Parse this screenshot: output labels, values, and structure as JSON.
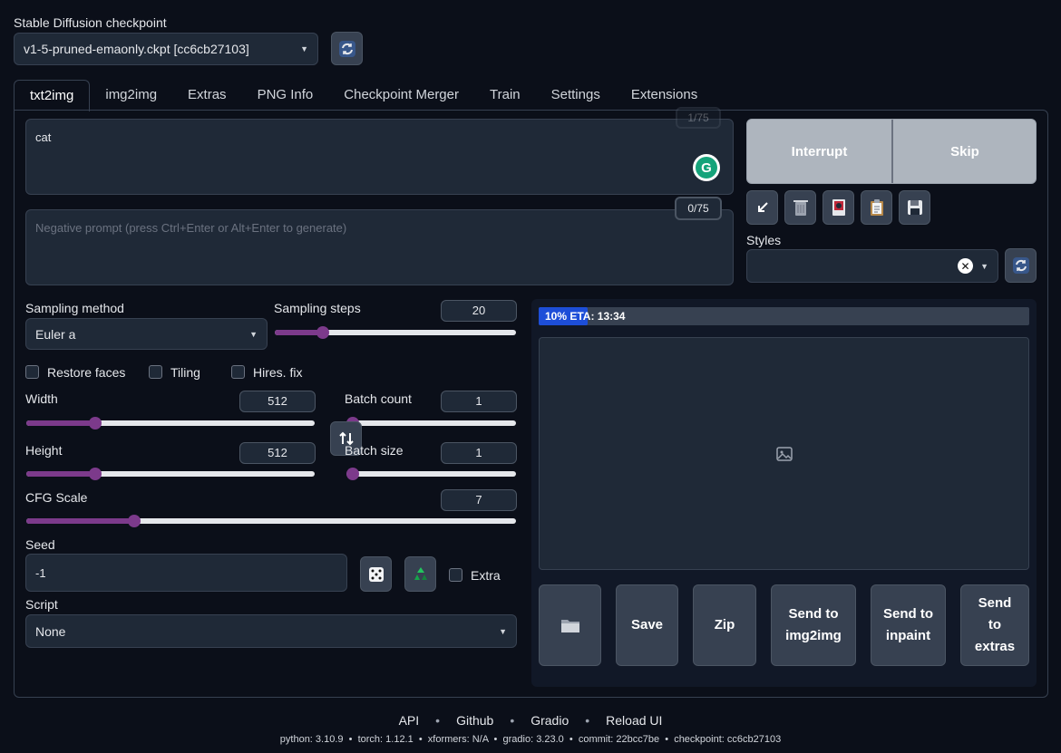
{
  "checkpoint": {
    "label": "Stable Diffusion checkpoint",
    "value": "v1-5-pruned-emaonly.ckpt [cc6cb27103]"
  },
  "tabs": [
    "txt2img",
    "img2img",
    "Extras",
    "PNG Info",
    "Checkpoint Merger",
    "Train",
    "Settings",
    "Extensions"
  ],
  "prompt": {
    "value": "cat",
    "counter": "1/75"
  },
  "negative_prompt": {
    "placeholder": "Negative prompt (press Ctrl+Enter or Alt+Enter to generate)",
    "counter": "0/75"
  },
  "actions": {
    "interrupt": "Interrupt",
    "skip": "Skip"
  },
  "styles": {
    "label": "Styles",
    "value": ""
  },
  "sampling": {
    "method_label": "Sampling method",
    "method_value": "Euler a",
    "steps_label": "Sampling steps",
    "steps_value": "20",
    "steps_fraction": 0.2
  },
  "options": {
    "restore_faces": "Restore faces",
    "tiling": "Tiling",
    "hires_fix": "Hires. fix"
  },
  "width": {
    "label": "Width",
    "value": "512",
    "fraction": 0.24
  },
  "height": {
    "label": "Height",
    "value": "512",
    "fraction": 0.24
  },
  "batch_count": {
    "label": "Batch count",
    "value": "1",
    "fraction": 0.0
  },
  "batch_size": {
    "label": "Batch size",
    "value": "1",
    "fraction": 0.0
  },
  "cfg": {
    "label": "CFG Scale",
    "value": "7",
    "fraction": 0.22
  },
  "seed": {
    "label": "Seed",
    "value": "-1",
    "extra": "Extra"
  },
  "script": {
    "label": "Script",
    "value": "None"
  },
  "progress": {
    "text": "10% ETA: 13:34",
    "fraction": 0.1
  },
  "output_buttons": {
    "save": "Save",
    "zip": "Zip",
    "send_img2img": "Send to img2img",
    "send_inpaint": "Send to inpaint",
    "send_extras": "Send to extras"
  },
  "footer": {
    "links": [
      "API",
      "Github",
      "Gradio",
      "Reload UI"
    ],
    "info": "python: 3.10.9  •  torch: 1.12.1  •  xformers: N/A  •  gradio: 3.23.0  •  commit: 22bcc7be  •  checkpoint: cc6cb27103"
  },
  "colors": {
    "accent": "#7c3a8b",
    "progress": "#1d4ed8",
    "background": "#0b0f19"
  }
}
